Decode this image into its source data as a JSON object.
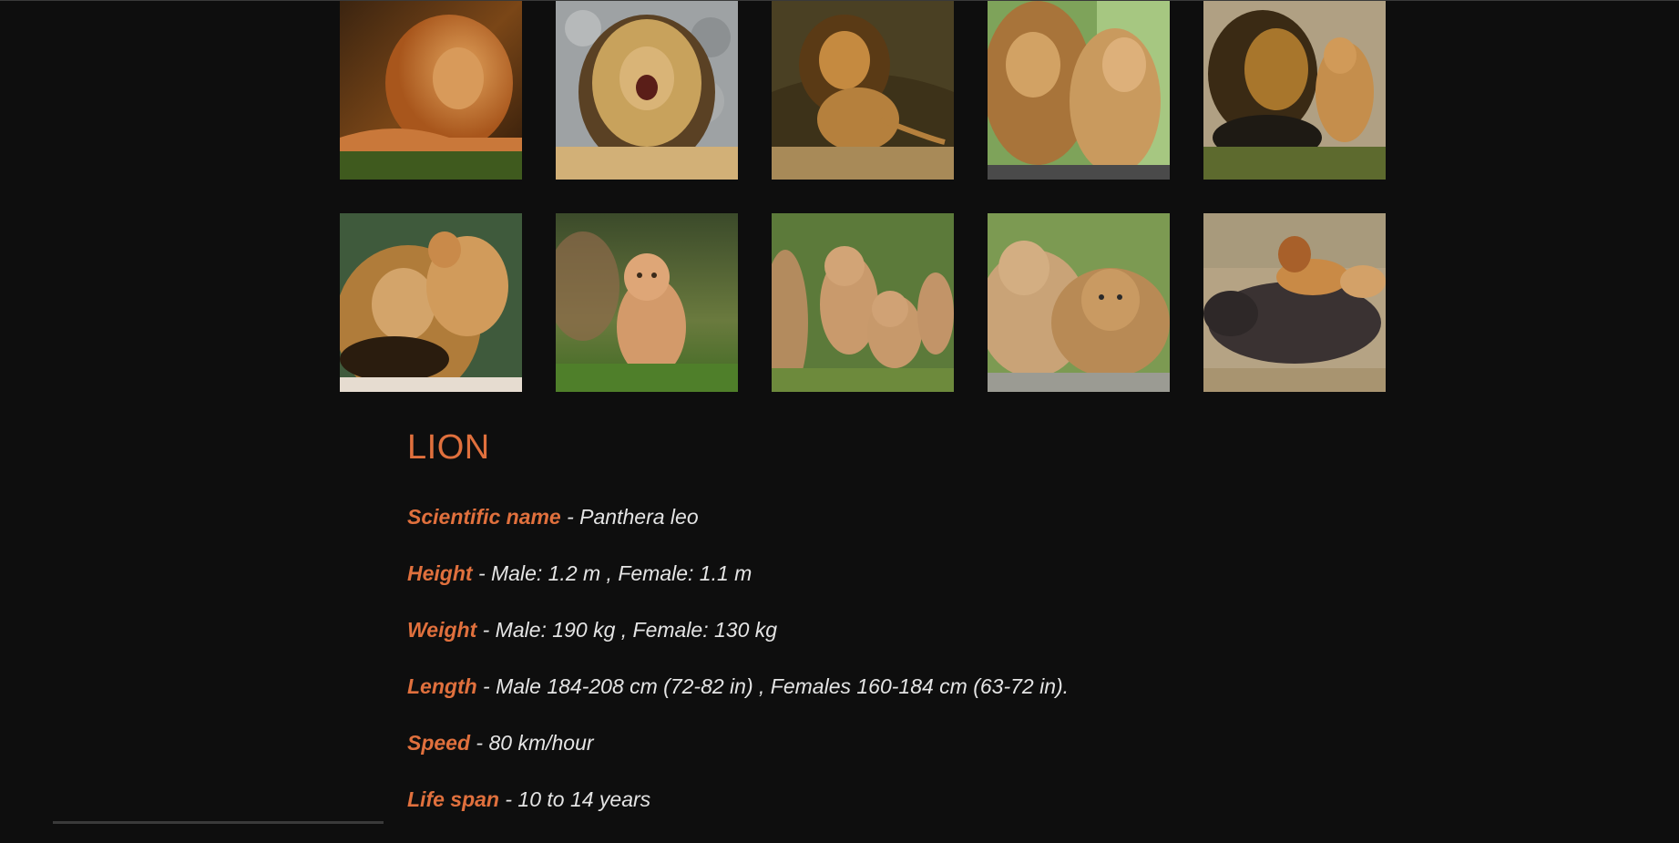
{
  "gallery": {
    "rows": [
      [
        {
          "name": "lion-lying-grass"
        },
        {
          "name": "lion-roaring"
        },
        {
          "name": "lion-walking-forest"
        },
        {
          "name": "lion-and-lioness"
        },
        {
          "name": "lion-and-cub-nuzzling"
        }
      ],
      [
        {
          "name": "cub-hugging-lion"
        },
        {
          "name": "lion-cub-walking"
        },
        {
          "name": "lion-cubs-group"
        },
        {
          "name": "lion-cubs-lying"
        },
        {
          "name": "lions-hunting-buffalo"
        }
      ]
    ]
  },
  "animal": {
    "title": "LION",
    "facts": [
      {
        "label": "Scientific name",
        "value": " - Panthera leo"
      },
      {
        "label": "Height",
        "value": " - Male: 1.2 m , Female: 1.1 m"
      },
      {
        "label": "Weight",
        "value": " - Male: 190 kg , Female: 130 kg"
      },
      {
        "label": "Length",
        "value": " - Male 184-208 cm (72-82 in) , Females 160-184 cm (63-72 in)."
      },
      {
        "label": "Speed",
        "value": " - 80 km/hour"
      },
      {
        "label": "Life span",
        "value": " - 10 to 14 years"
      }
    ]
  },
  "colors": {
    "background": "#0e0e0e",
    "accent": "#e0703d",
    "text": "#e4e4e4"
  }
}
